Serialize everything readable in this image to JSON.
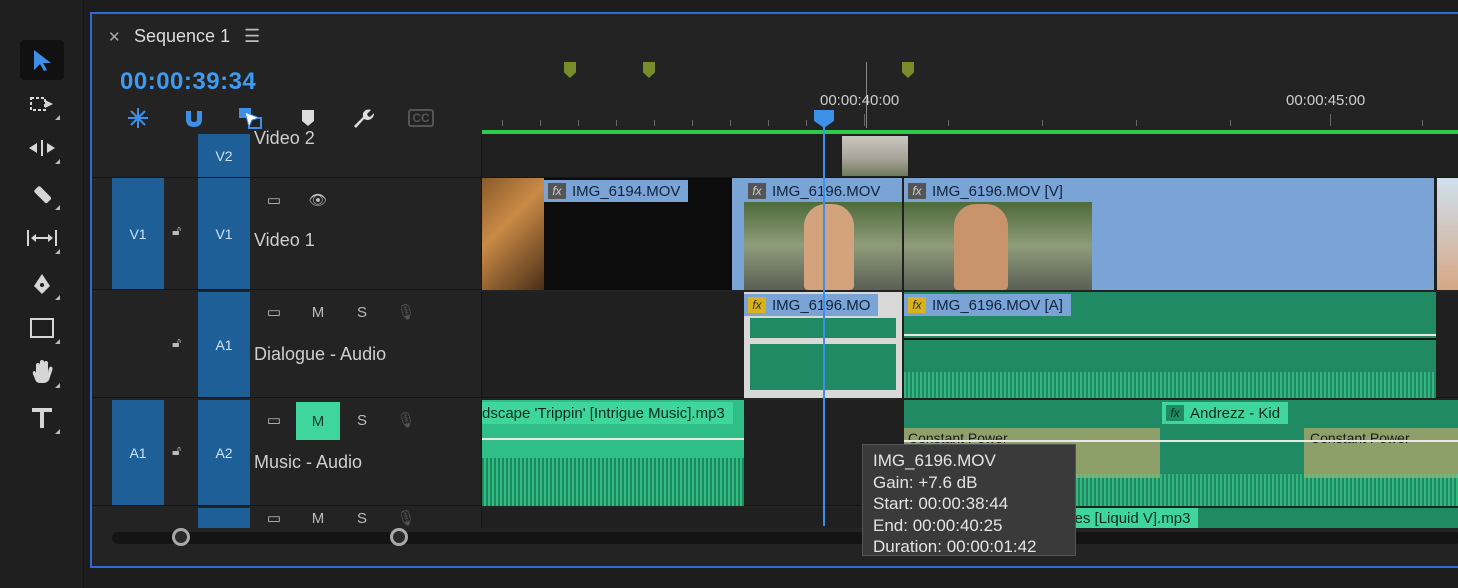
{
  "colors": {
    "accent": "#2d6bd6",
    "timecode": "#3d9bf2",
    "video_clip": "#7aa3d6",
    "audio_clip": "#1f8a63",
    "music_clip": "#3ed69c",
    "work_area": "#2ecb4a"
  },
  "sequence": {
    "title": "Sequence 1",
    "timecode": "00:00:39:34"
  },
  "ruler": {
    "labels": [
      "00:00:40:00",
      "00:00:45:00"
    ]
  },
  "tracks": {
    "v2": {
      "target": "V2",
      "name": "Video 2"
    },
    "v1": {
      "source": "V1",
      "target": "V1",
      "name": "Video 1"
    },
    "a1": {
      "target": "A1",
      "name": "Dialogue - Audio",
      "m": "M",
      "s": "S"
    },
    "a2": {
      "source": "A1",
      "target": "A2",
      "name": "Music - Audio",
      "m": "M",
      "s": "S"
    },
    "a3": {
      "m": "M",
      "s": "S"
    }
  },
  "clips": {
    "v1_a": "IMG_6194.MOV",
    "v1_b": "IMG_6196.MOV",
    "v1_c": "IMG_6196.MOV [V]",
    "a1_a": "IMG_6196.MO",
    "a1_b": "IMG_6196.MOV [A]",
    "a2_a": "dscape 'Trippin' [Intrigue Music].mp3",
    "a2_b": "Andrezz - Kid",
    "a2_t1": "Constant Power",
    "a2_t2": "Constant Power",
    "a3_a": "otes [Liquid V].mp3",
    "fx": "fx"
  },
  "tooltip": {
    "name": "IMG_6196.MOV",
    "gain": "Gain: +7.6 dB",
    "start": "Start: 00:00:38:44",
    "end": "End: 00:00:40:25",
    "duration": "Duration: 00:00:01:42"
  },
  "icons": {
    "close": "close-icon",
    "menu": "hamburger-icon",
    "lock": "lock-icon"
  },
  "toolbar": {
    "cc": "CC"
  }
}
